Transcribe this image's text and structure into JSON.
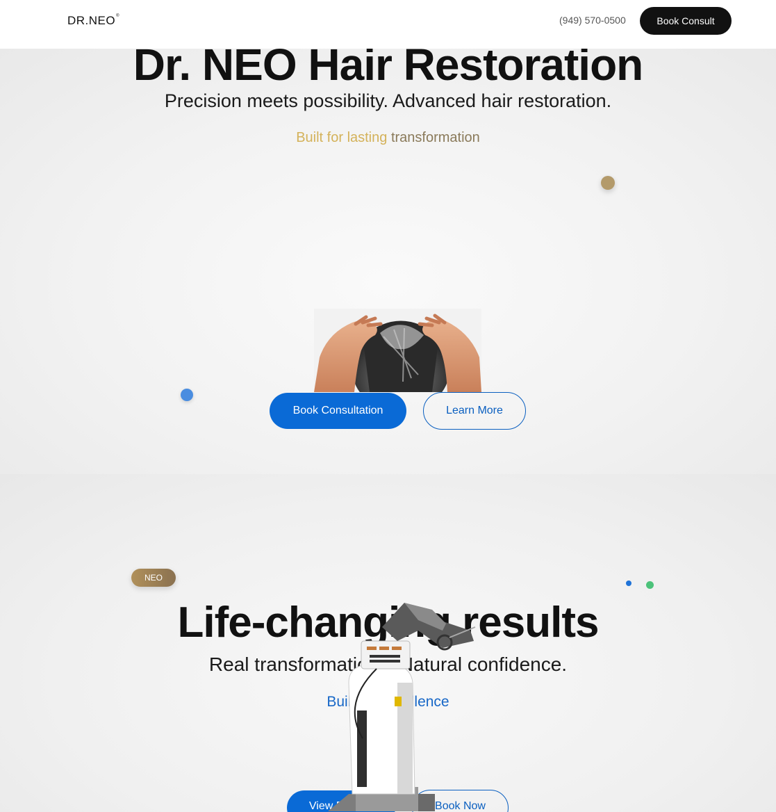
{
  "header": {
    "logo_text": "DR.NEO",
    "logo_mark": "®",
    "phone": "(949) 570-0500",
    "cta_label": "Book Consult"
  },
  "hero": {
    "title": "Dr. NEO Hair Restoration",
    "subtitle": "Precision meets possibility. Advanced hair restoration.",
    "tagline_part1": "Built for lasting ",
    "tagline_part2": "transformation",
    "primary_button": "Book Consultation",
    "secondary_button": "Learn More",
    "image": "hair-loss-photo"
  },
  "results": {
    "badge": "NEO",
    "title": "Life-changing results",
    "subtitle": "Real transformations. Natural confidence.",
    "tagline": "Built for excellence",
    "primary_button": "View Results",
    "secondary_button": "Book Now",
    "image": "robotic-device-image"
  },
  "colors": {
    "accent_blue": "#0a6ad6",
    "gold": "#b39a6a",
    "dark": "#111111"
  }
}
